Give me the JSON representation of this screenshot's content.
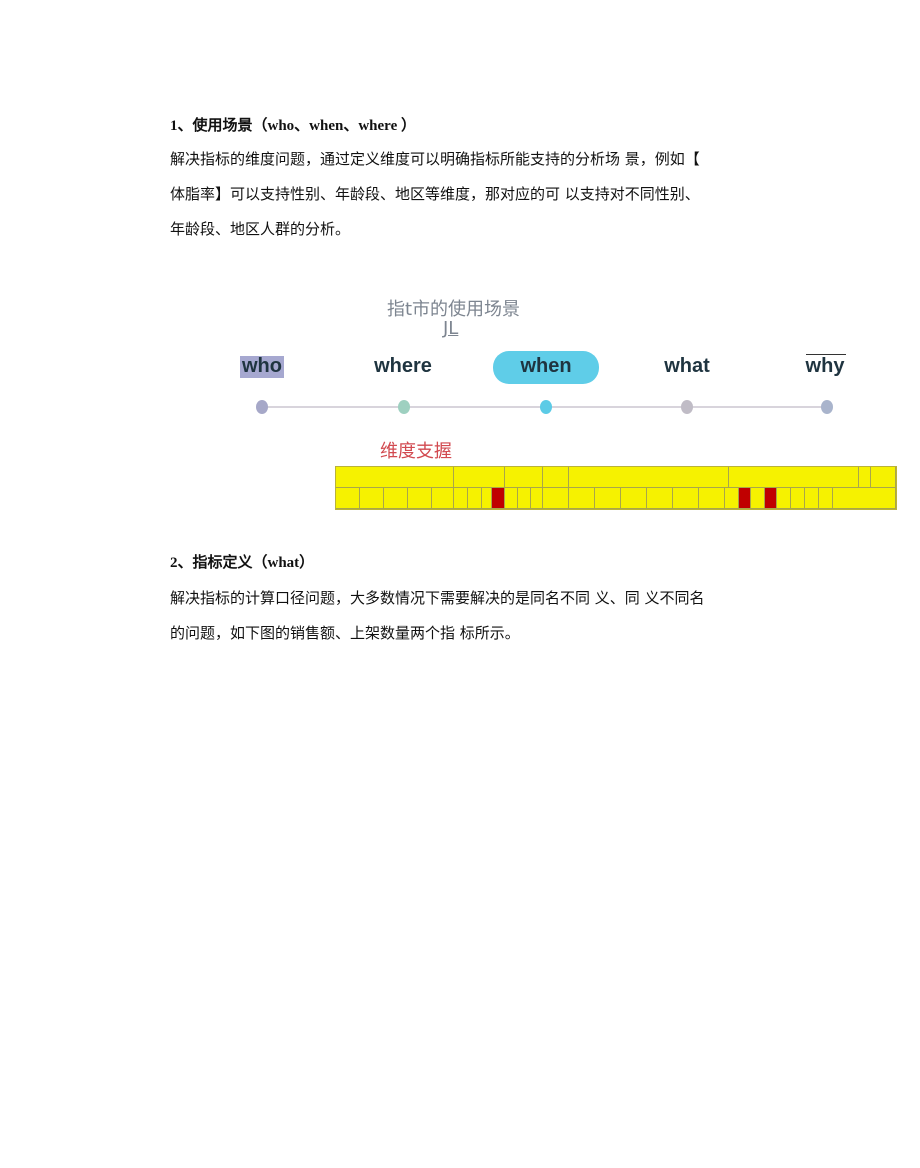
{
  "section1": {
    "heading": "1、使用场景（who、when、where ）",
    "lines": [
      "解决指标的维度问题，通过定义维度可以明确指标所能支持的分析场 景，例如【",
      "体脂率】可以支持性别、年龄段、地区等维度，那对应的可 以支持对不同性别、",
      "年龄段、地区人群的分析。"
    ]
  },
  "diagram": {
    "title": "指t市的使用场景",
    "subtitle": "JL",
    "steps": [
      {
        "label": "who",
        "dot_color": "#a6a8c8"
      },
      {
        "label": "where",
        "dot_color": "#9ed0c0"
      },
      {
        "label": "when",
        "dot_color": "#5ccbe6",
        "highlight": true
      },
      {
        "label": "what",
        "dot_color": "#c0bcc6"
      },
      {
        "label": "why",
        "dot_color": "#a9b4cc"
      }
    ],
    "dimension_label": "维度支握",
    "colors": {
      "highlight": "#5fcde8",
      "table": "#f6f200",
      "table_mark": "#c00000",
      "dimension_label": "#d24a50"
    }
  },
  "section2": {
    "heading": "2、指标定义（what）",
    "lines": [
      "解决指标的计算口径问题，大多数情况下需要解决的是同名不同 义、同 义不同名",
      "的问题，如下图的销售额、上架数量两个指 标所示。"
    ]
  }
}
